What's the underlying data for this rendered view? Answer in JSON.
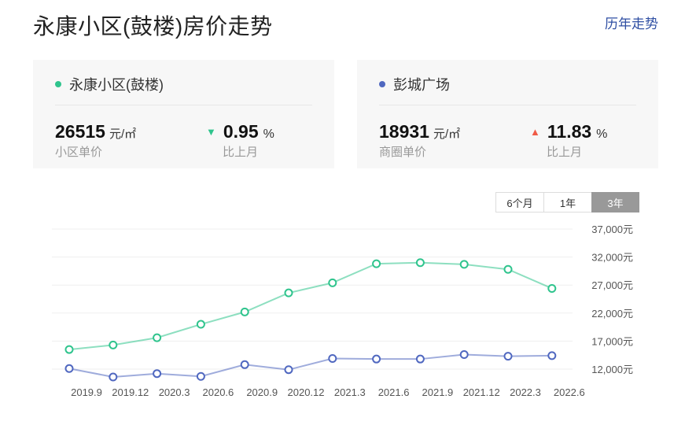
{
  "header": {
    "title": "永康小区(鼓楼)房价走势",
    "history_link": "历年走势"
  },
  "cards": [
    {
      "name": "永康小区(鼓楼)",
      "color": "#2fc48d",
      "price": "26515",
      "price_unit": "元/㎡",
      "price_label": "小区单价",
      "change": "0.95",
      "change_unit": "%",
      "change_direction": "down",
      "change_arrow": "▼",
      "change_label": "比上月"
    },
    {
      "name": "彭城广场",
      "color": "#5068c0",
      "price": "18931",
      "price_unit": "元/㎡",
      "price_label": "商圈单价",
      "change": "11.83",
      "change_unit": "%",
      "change_direction": "up",
      "change_arrow": "▲",
      "change_label": "比上月"
    }
  ],
  "range_tabs": [
    {
      "label": "6个月",
      "active": false
    },
    {
      "label": "1年",
      "active": false
    },
    {
      "label": "3年",
      "active": true
    }
  ],
  "chart_data": {
    "type": "line",
    "x_tick_labels": [
      "2019.9",
      "2019.12",
      "2020.3",
      "2020.6",
      "2020.9",
      "2020.12",
      "2021.3",
      "2021.6",
      "2021.9",
      "2021.12",
      "2022.3",
      "2022.6"
    ],
    "y_ticks": [
      12000,
      17000,
      22000,
      27000,
      32000,
      37000
    ],
    "y_tick_labels": [
      "12,000元",
      "17,000元",
      "22,000元",
      "27,000元",
      "32,000元",
      "37,000元"
    ],
    "ylim": [
      12000,
      37000
    ],
    "grid": true,
    "y_axis_position": "right",
    "series": [
      {
        "color": "#2fc48d",
        "values": [
          15500,
          16300,
          17600,
          20000,
          22200,
          25600,
          27400,
          30800,
          31000,
          30700,
          29800,
          26400
        ]
      },
      {
        "color": "#5068c0",
        "values": [
          12100,
          10600,
          11200,
          10700,
          12800,
          11900,
          13900,
          13800,
          13800,
          14600,
          14300,
          14400
        ]
      }
    ]
  }
}
